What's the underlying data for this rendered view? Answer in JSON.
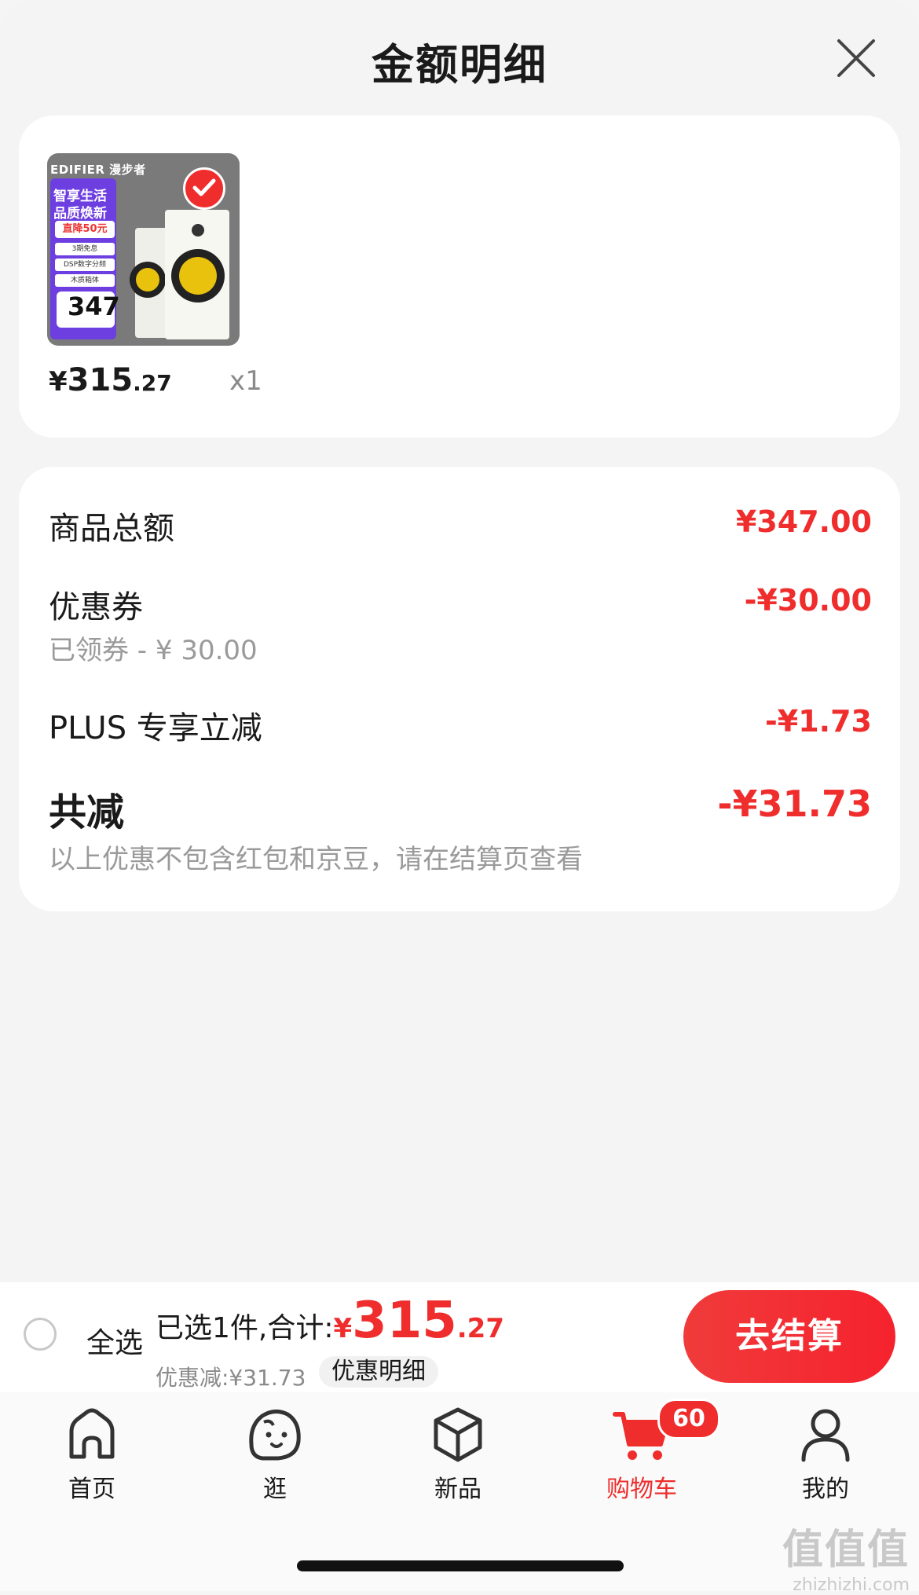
{
  "header": {
    "title": "金额明细"
  },
  "product": {
    "thumbnail": {
      "brand": "EDIFIER 漫步者",
      "promo_line1": "智享生活",
      "promo_line2": "品质焕新",
      "promo_tag": "直降50元",
      "promo_item1": "3期免息",
      "promo_item2": "DSP数字分频",
      "promo_item3": "木质箱体",
      "promo_price": "347"
    },
    "price_symbol": "¥",
    "price_int": "315",
    "price_dec": ".27",
    "quantity": "x1"
  },
  "amounts": {
    "goods_total_label": "商品总额",
    "goods_total_value": "¥347.00",
    "coupon_label": "优惠券",
    "coupon_value": "-¥30.00",
    "coupon_sub": "已领券 - ¥ 30.00",
    "plus_label": "PLUS 专享立减",
    "plus_value": "-¥1.73",
    "total_off_label": "共减",
    "total_off_value": "-¥31.73",
    "note": "以上优惠不包含红包和京豆，请在结算页查看"
  },
  "bottom_bar": {
    "select_all": "全选",
    "summary_prefix": "已选1件,合计:",
    "total_symbol": "¥",
    "total_int": "315",
    "total_dec": ".27",
    "discount_text": "优惠减:¥31.73",
    "detail_button": "优惠明细",
    "checkout_button": "去结算"
  },
  "tabs": [
    {
      "label": "首页",
      "icon": "home-icon"
    },
    {
      "label": "逛",
      "icon": "face-icon"
    },
    {
      "label": "新品",
      "icon": "cube-icon"
    },
    {
      "label": "购物车",
      "icon": "cart-icon",
      "badge": "60",
      "active": true
    },
    {
      "label": "我的",
      "icon": "person-icon"
    }
  ],
  "watermark": {
    "big": "值值值",
    "small": "zhizhizhi.com"
  },
  "colors": {
    "accent": "#ef2d2d",
    "background": "#f4f4f4",
    "card": "#ffffff",
    "muted": "#9a9a9a"
  }
}
